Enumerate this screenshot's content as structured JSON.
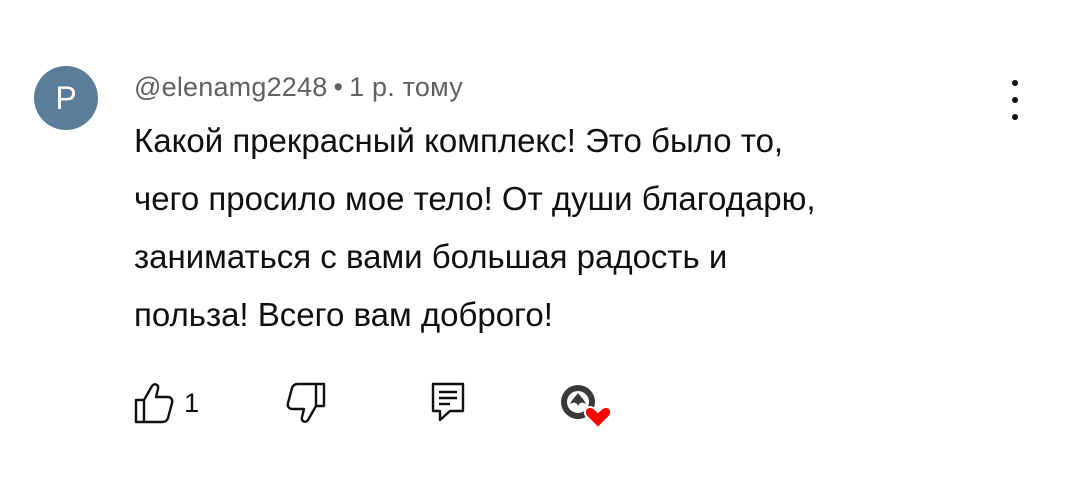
{
  "comment": {
    "avatar_letter": "P",
    "avatar_color": "#5c7d99",
    "author": "@elenamg2248",
    "separator": "•",
    "time": "1 р. тому",
    "text": "Какой прекрасный комплекс! Это было то,\nчего просило мое тело! От души благодарю,\nзаниматься с вами  большая радость и\nпольза! Всего вам доброго!",
    "like_count": "1",
    "icons": {
      "more": "more-vert-icon",
      "like": "thumb-up-icon",
      "dislike": "thumb-down-icon",
      "reply": "reply-icon",
      "creator_heart": "creator-heart-icon"
    },
    "heart_color": "#ff0000"
  }
}
